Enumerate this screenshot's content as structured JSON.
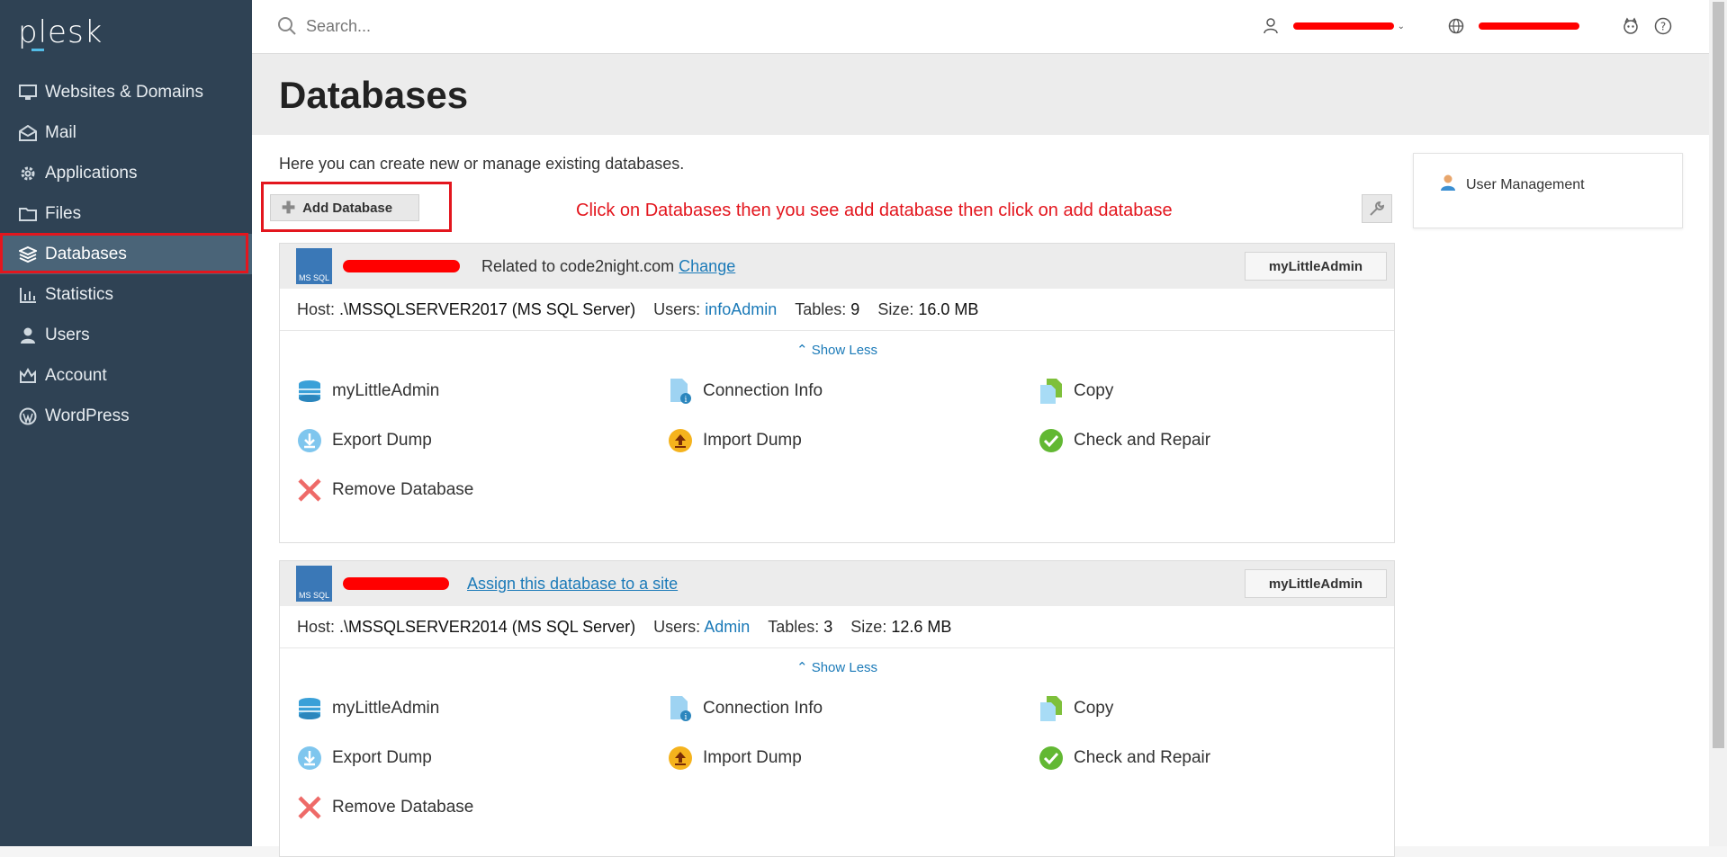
{
  "app": {
    "logo": "plesk"
  },
  "sidebar": {
    "items": [
      {
        "label": "Websites & Domains",
        "icon": "monitor-icon"
      },
      {
        "label": "Mail",
        "icon": "mail-icon"
      },
      {
        "label": "Applications",
        "icon": "gear-icon"
      },
      {
        "label": "Files",
        "icon": "folder-icon"
      },
      {
        "label": "Databases",
        "icon": "layers-icon",
        "active": true
      },
      {
        "label": "Statistics",
        "icon": "bar-chart-icon"
      },
      {
        "label": "Users",
        "icon": "user-icon"
      },
      {
        "label": "Account",
        "icon": "crown-icon"
      },
      {
        "label": "WordPress",
        "icon": "wordpress-icon"
      }
    ]
  },
  "topbar": {
    "search_placeholder": "Search..."
  },
  "page": {
    "title": "Databases",
    "intro": "Here you can create new or manage existing databases.",
    "add_button": "Add Database",
    "annotation": "Click on Databases then you see add database then click on add database",
    "right_panel": {
      "user_management": "User Management"
    }
  },
  "databases": [
    {
      "related_prefix": "Related to code2night.com",
      "change": "Change",
      "my_little_admin": "myLittleAdmin",
      "host_label": "Host:",
      "host": ".\\MSSQLSERVER2017 (MS SQL Server)",
      "users_label": "Users:",
      "users": "infoAdmin",
      "tables_label": "Tables:",
      "tables": "9",
      "size_label": "Size:",
      "size": "16.0 MB",
      "show_less": "Show Less",
      "actions": [
        "myLittleAdmin",
        "Connection Info",
        "Copy",
        "Export Dump",
        "Import Dump",
        "Check and Repair",
        "Remove Database"
      ]
    },
    {
      "assign": "Assign this database to a site",
      "my_little_admin": "myLittleAdmin",
      "host_label": "Host:",
      "host": ".\\MSSQLSERVER2014 (MS SQL Server)",
      "users_label": "Users:",
      "users": "Admin",
      "tables_label": "Tables:",
      "tables": "3",
      "size_label": "Size:",
      "size": "12.6 MB",
      "show_less": "Show Less",
      "actions": [
        "myLittleAdmin",
        "Connection Info",
        "Copy",
        "Export Dump",
        "Import Dump",
        "Check and Repair",
        "Remove Database"
      ]
    }
  ],
  "colors": {
    "sidebar": "#2f4254",
    "active": "#4a6478",
    "link": "#1b7ab8",
    "annotation": "#e3161e"
  }
}
